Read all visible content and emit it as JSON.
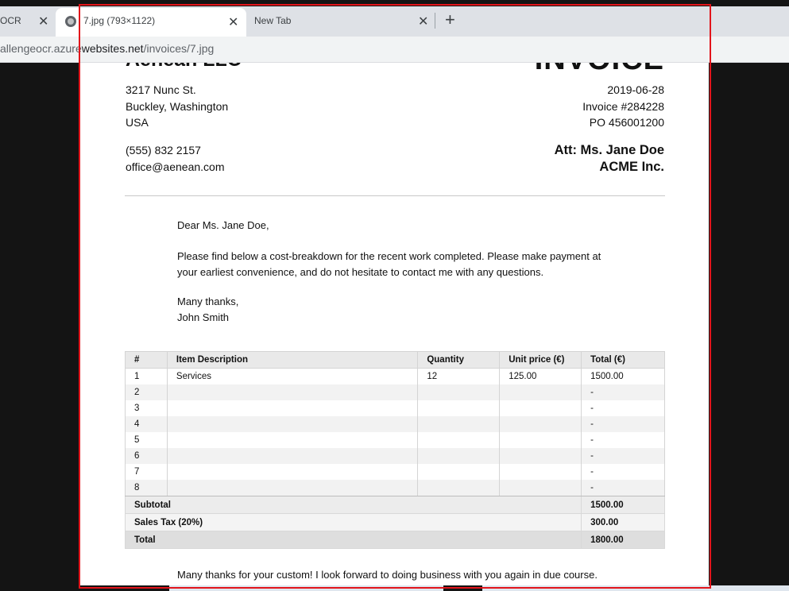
{
  "browser": {
    "tabs": [
      {
        "title": "OCR",
        "active": false
      },
      {
        "title": "7.jpg (793×1122)",
        "active": true
      },
      {
        "title": "New Tab",
        "active": false
      }
    ],
    "close_glyph": "✕",
    "new_tab_glyph": "+",
    "address": {
      "prefix": "allengeocr.azure",
      "host": "websites.net",
      "path": "/invoices/7.jpg"
    }
  },
  "invoice": {
    "company_name": "Aenean LLC",
    "doc_title": "INVOICE",
    "from_address": [
      "3217 Nunc St.",
      "Buckley, Washington",
      "USA"
    ],
    "contact": [
      "(555) 832 2157",
      "office@aenean.com"
    ],
    "date": "2019-06-28",
    "invoice_number": "Invoice #284228",
    "po_number": "PO 456001200",
    "att": "Att: Ms. Jane Doe",
    "client": "ACME Inc.",
    "greeting": "Dear Ms. Jane Doe,",
    "body_line1": "Please find below a cost-breakdown for the recent work completed. Please make payment at",
    "body_line2": "your earliest convenience, and do not hesitate to contact me with any questions.",
    "signoff": "Many thanks,",
    "signer": "John Smith",
    "table": {
      "headers": [
        "#",
        "Item Description",
        "Quantity",
        "Unit price (€)",
        "Total (€)"
      ],
      "rows": [
        [
          "1",
          "Services",
          "12",
          "125.00",
          "1500.00"
        ],
        [
          "2",
          "",
          "",
          "",
          "-"
        ],
        [
          "3",
          "",
          "",
          "",
          "-"
        ],
        [
          "4",
          "",
          "",
          "",
          "-"
        ],
        [
          "5",
          "",
          "",
          "",
          "-"
        ],
        [
          "6",
          "",
          "",
          "",
          "-"
        ],
        [
          "7",
          "",
          "",
          "",
          "-"
        ],
        [
          "8",
          "",
          "",
          "",
          "-"
        ]
      ],
      "subtotal_label": "Subtotal",
      "subtotal_value": "1500.00",
      "tax_label": "Sales Tax (20%)",
      "tax_value": "300.00",
      "total_label": "Total",
      "total_value": "1800.00"
    },
    "closing": "Many thanks for your custom! I look forward to doing business with you again in due course."
  },
  "colors": {
    "selection_border": "#e2141b",
    "page_background": "#141414",
    "tabbar": "#dee1e6"
  }
}
